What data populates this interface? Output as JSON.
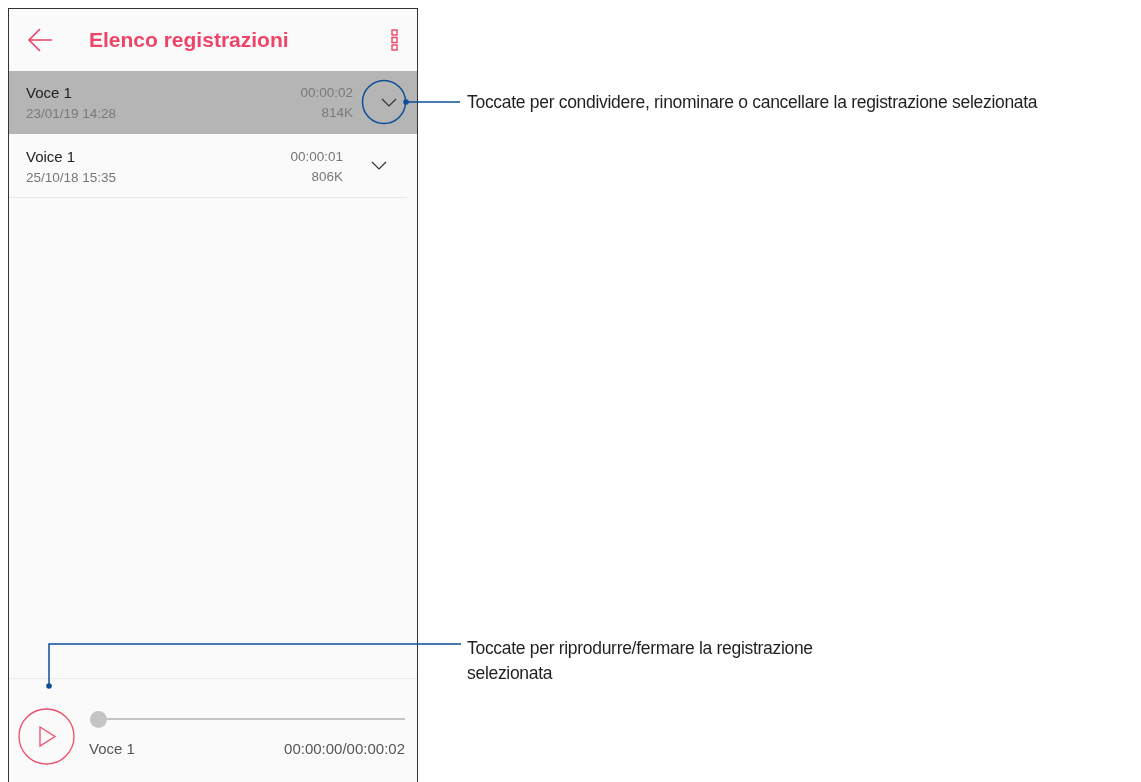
{
  "header": {
    "title": "Elenco registrazioni"
  },
  "recordings": [
    {
      "name": "Voce 1",
      "date": "23/01/19 14:28",
      "duration": "00:00:02",
      "size": "814K",
      "selected": true
    },
    {
      "name": "Voice 1",
      "date": "25/10/18 15:35",
      "duration": "00:00:01",
      "size": "806K",
      "selected": false
    }
  ],
  "player": {
    "track": "Voce 1",
    "time": "00:00:00/00:00:02",
    "level": 0
  },
  "callouts": [
    {
      "text": "Toccate per condividere, rinominare o cancellare la registrazione selezionata"
    },
    {
      "text": "Toccate per riprodurre/fermare la registrazione selezionata"
    }
  ]
}
